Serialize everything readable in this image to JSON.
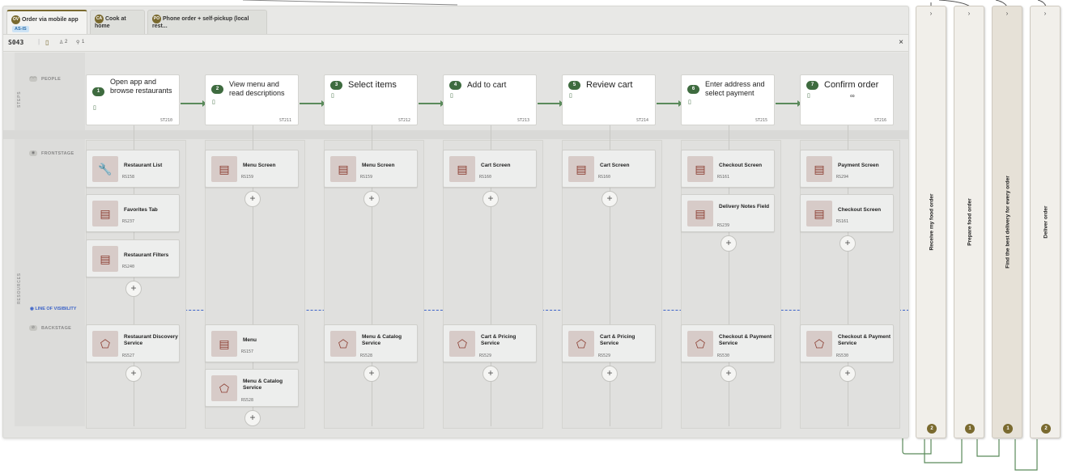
{
  "tabs": [
    {
      "badge": "OV",
      "label": "Order via mobile app",
      "tag": "AS-IS"
    },
    {
      "badge": "CA",
      "label": "Cook at home"
    },
    {
      "badge": "PO",
      "label": "Phone order + self-pickup (local rest..."
    }
  ],
  "subbar": {
    "code": "S043",
    "persona_count": "2",
    "pin_count": "1",
    "close": "×"
  },
  "lanes": {
    "steps": "STEPS",
    "people": "PEOPLE",
    "frontstage": "FRONTSTAGE",
    "resources": "RESOURCES",
    "line_of_visibility": "LINE OF VISIBILITY",
    "backstage": "BACKSTAGE"
  },
  "steps": [
    {
      "num": "1",
      "title": "Open app and browse restaurants",
      "code": "ST210"
    },
    {
      "num": "2",
      "title": "View menu and read descriptions",
      "code": "ST211"
    },
    {
      "num": "3",
      "title": "Select items",
      "code": "ST212"
    },
    {
      "num": "4",
      "title": "Add to cart",
      "code": "ST213"
    },
    {
      "num": "5",
      "title": "Review cart",
      "code": "ST214"
    },
    {
      "num": "6",
      "title": "Enter address and select payment",
      "code": "ST215"
    },
    {
      "num": "7",
      "title": "Confirm order",
      "code": "ST216",
      "extra_icon": "∞"
    }
  ],
  "frontstage": [
    [
      {
        "name": "Restaurant List",
        "code": "RS158",
        "icon": "wrench-icon"
      },
      {
        "name": "Favorites Tab",
        "code": "RS237",
        "icon": "archive-icon"
      },
      {
        "name": "Restaurant Filters",
        "code": "RS240",
        "icon": "archive-icon"
      }
    ],
    [
      {
        "name": "Menu Screen",
        "code": "RS159",
        "icon": "archive-icon"
      }
    ],
    [
      {
        "name": "Menu Screen",
        "code": "RS159",
        "icon": "archive-icon"
      }
    ],
    [
      {
        "name": "Cart Screen",
        "code": "RS160",
        "icon": "archive-icon"
      }
    ],
    [
      {
        "name": "Cart Screen",
        "code": "RS160",
        "icon": "archive-icon"
      }
    ],
    [
      {
        "name": "Checkout Screen",
        "code": "RS161",
        "icon": "archive-icon"
      },
      {
        "name": "Delivery Notes Field",
        "code": "RS239",
        "icon": "archive-icon"
      }
    ],
    [
      {
        "name": "Payment Screen",
        "code": "RS294",
        "icon": "archive-icon"
      },
      {
        "name": "Checkout Screen",
        "code": "RS161",
        "icon": "archive-icon"
      }
    ]
  ],
  "backstage": [
    [
      {
        "name": "Restaurant Discovery Service",
        "code": "RS527",
        "icon": "service-icon"
      }
    ],
    [
      {
        "name": "Menu",
        "code": "RS157",
        "icon": "document-icon"
      },
      {
        "name": "Menu & Catalog Service",
        "code": "RS528",
        "icon": "service-icon"
      }
    ],
    [
      {
        "name": "Menu & Catalog Service",
        "code": "RS528",
        "icon": "service-icon"
      }
    ],
    [
      {
        "name": "Cart & Pricing Service",
        "code": "RS529",
        "icon": "service-icon"
      }
    ],
    [
      {
        "name": "Cart & Pricing Service",
        "code": "RS529",
        "icon": "service-icon"
      }
    ],
    [
      {
        "name": "Checkout & Payment Service",
        "code": "RS530",
        "icon": "service-icon"
      }
    ],
    [
      {
        "name": "Checkout & Payment Service",
        "code": "RS530",
        "icon": "service-icon"
      }
    ]
  ],
  "add_symbol": "+",
  "pillars": [
    {
      "label": "Receive my food order",
      "count": "2"
    },
    {
      "label": "Prepare food order",
      "count": "1"
    },
    {
      "label": "Find the best delivery for every order",
      "count": "1"
    },
    {
      "label": "Deliver order",
      "count": "2"
    }
  ],
  "colors": {
    "accent": "#3e6b3f",
    "brand": "#7a6a2f",
    "visibility": "#3d64c8"
  }
}
